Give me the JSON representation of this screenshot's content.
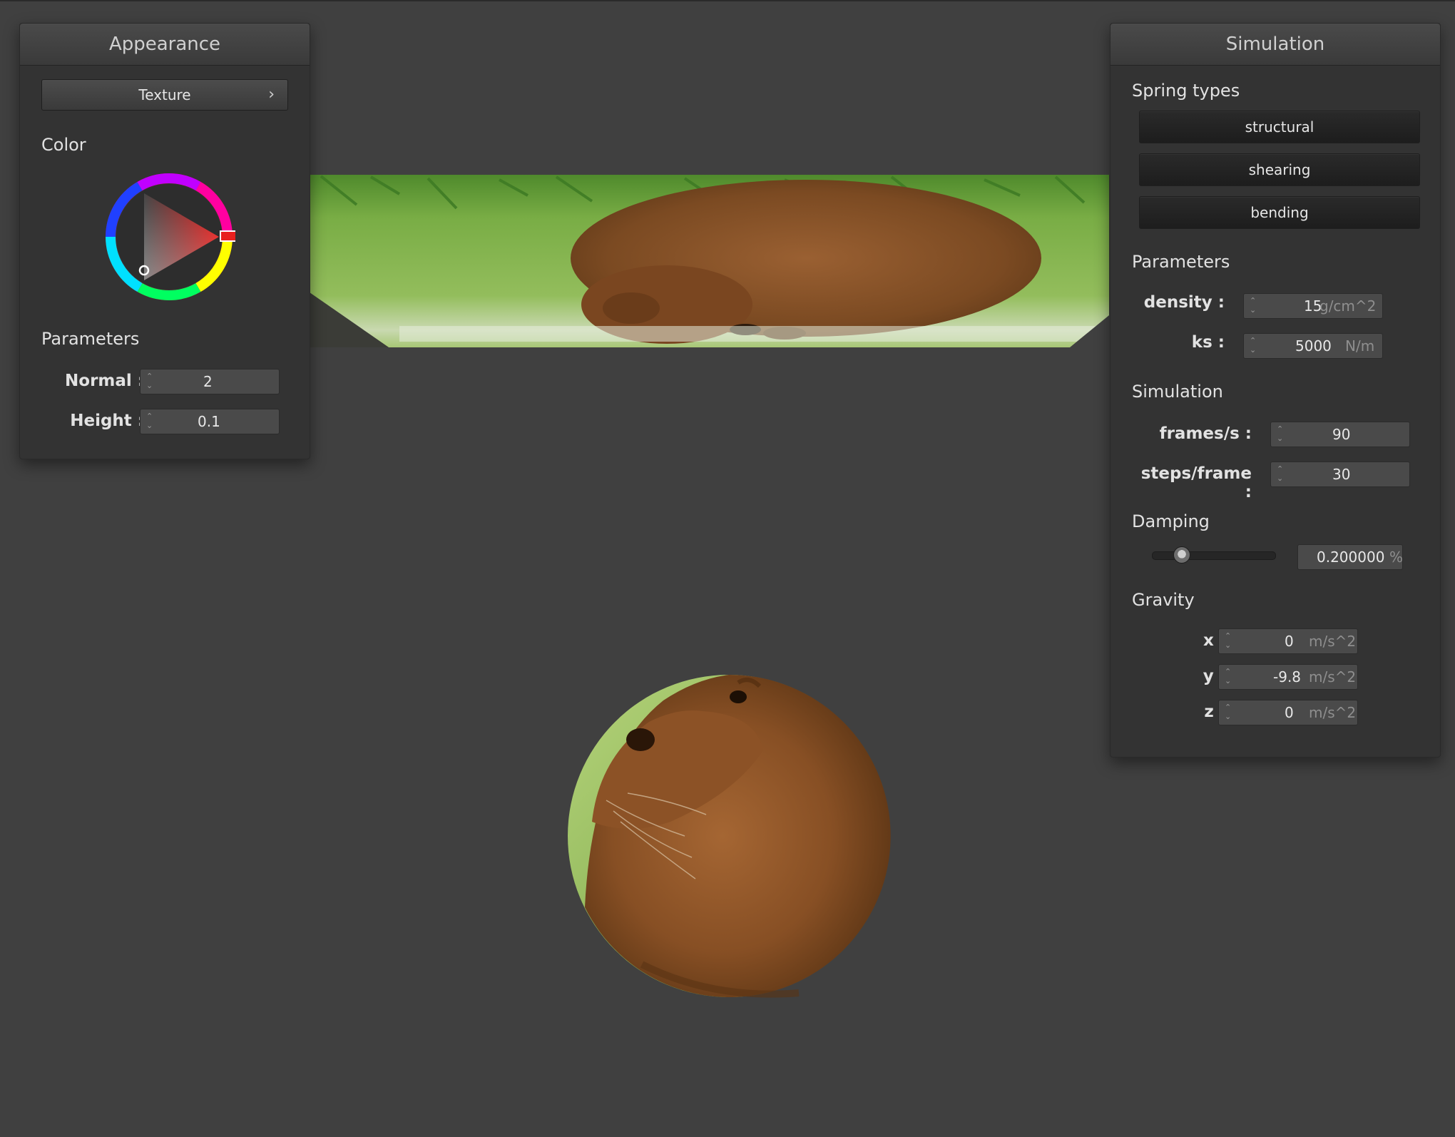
{
  "appearance_panel": {
    "title": "Appearance",
    "texture_button": "Texture",
    "texture_chevron": "›",
    "color_label": "Color",
    "color": {
      "hue_hex": "#e8201e"
    },
    "parameters_label": "Parameters",
    "normal": {
      "label": "Normal :",
      "value": "2"
    },
    "height": {
      "label": "Height :",
      "value": "0.1"
    }
  },
  "simulation_panel": {
    "title": "Simulation",
    "spring_types_label": "Spring types",
    "spring_types": [
      "structural",
      "shearing",
      "bending"
    ],
    "parameters_label": "Parameters",
    "density": {
      "label": "density :",
      "value": "15",
      "unit": "g/cm^2"
    },
    "ks": {
      "label": "ks :",
      "value": "5000",
      "unit": "N/m"
    },
    "simulation_label": "Simulation",
    "frames_per_s": {
      "label": "frames/s :",
      "value": "90"
    },
    "steps_per_frame": {
      "label": "steps/frame :",
      "value": "30"
    },
    "damping_label": "Damping",
    "damping": {
      "value": "0.200000",
      "unit": "%",
      "slider_fraction": 0.2
    },
    "gravity_label": "Gravity",
    "gravity": {
      "x": {
        "label": "x :",
        "value": "0",
        "unit": "m/s^2"
      },
      "y": {
        "label": "y :",
        "value": "-9.8",
        "unit": "m/s^2"
      },
      "z": {
        "label": "z :",
        "value": "0",
        "unit": "m/s^2"
      }
    }
  },
  "colors": {
    "background": "#404040",
    "panel": "#333333",
    "grass": "#7fb548",
    "fur": "#8a5428"
  }
}
